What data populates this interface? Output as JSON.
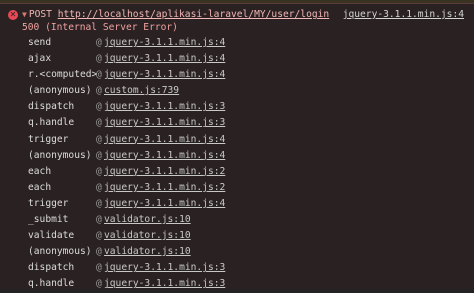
{
  "error": {
    "method": "POST",
    "url": "http://localhost/aplikasi-laravel/MY/user/login",
    "source": "jquery-3.1.1.min.js:4",
    "status": "500 (Internal Server Error)"
  },
  "stack": {
    "at_symbol": "@",
    "frames": [
      {
        "fn": "send",
        "src": "jquery-3.1.1.min.js:4"
      },
      {
        "fn": "ajax",
        "src": "jquery-3.1.1.min.js:4"
      },
      {
        "fn": "r.<computed>",
        "src": "jquery-3.1.1.min.js:4"
      },
      {
        "fn": "(anonymous)",
        "src": "custom.js:739"
      },
      {
        "fn": "dispatch",
        "src": "jquery-3.1.1.min.js:3"
      },
      {
        "fn": "q.handle",
        "src": "jquery-3.1.1.min.js:3"
      },
      {
        "fn": "trigger",
        "src": "jquery-3.1.1.min.js:4"
      },
      {
        "fn": "(anonymous)",
        "src": "jquery-3.1.1.min.js:4"
      },
      {
        "fn": "each",
        "src": "jquery-3.1.1.min.js:2"
      },
      {
        "fn": "each",
        "src": "jquery-3.1.1.min.js:2"
      },
      {
        "fn": "trigger",
        "src": "jquery-3.1.1.min.js:4"
      },
      {
        "fn": "_submit",
        "src": "validator.js:10"
      },
      {
        "fn": "validate",
        "src": "validator.js:10"
      },
      {
        "fn": "(anonymous)",
        "src": "validator.js:10"
      },
      {
        "fn": "dispatch",
        "src": "jquery-3.1.1.min.js:3"
      },
      {
        "fn": "q.handle",
        "src": "jquery-3.1.1.min.js:3"
      }
    ]
  }
}
